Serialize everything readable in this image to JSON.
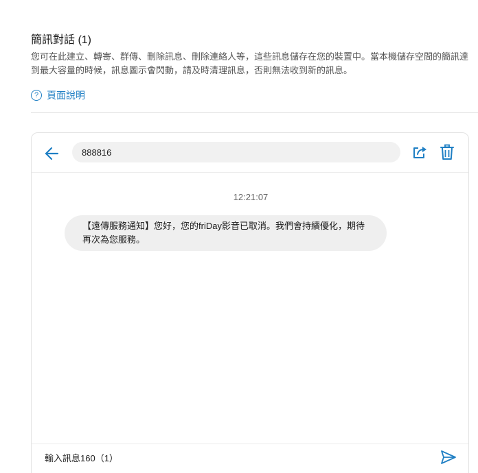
{
  "page": {
    "title": "簡訊對話 (1)",
    "description": "您可在此建立、轉寄、群傳、刪除訊息、刪除連絡人等，這些訊息儲存在您的裝置中。當本機儲存空間的簡訊達到最大容量的時候，訊息圖示會閃動，請及時清理訊息，否則無法收到新的訊息。",
    "help_icon": "?",
    "help_label": "頁面說明"
  },
  "conversation": {
    "number": "888816",
    "messages": [
      {
        "time": "12:21:07",
        "text": "【遠傳服務通知】您好，您的friDay影音已取消。我們會持續優化，期待再次為您服務。"
      }
    ]
  },
  "composer": {
    "placeholder": "輸入訊息160（1）"
  },
  "icons": {
    "back": "arrow-left-icon",
    "share": "share-icon",
    "delete": "trash-icon",
    "send": "send-icon"
  },
  "colors": {
    "accent": "#1f7fc4",
    "bubble": "#efefef",
    "input_bg": "#f1f1f1"
  }
}
